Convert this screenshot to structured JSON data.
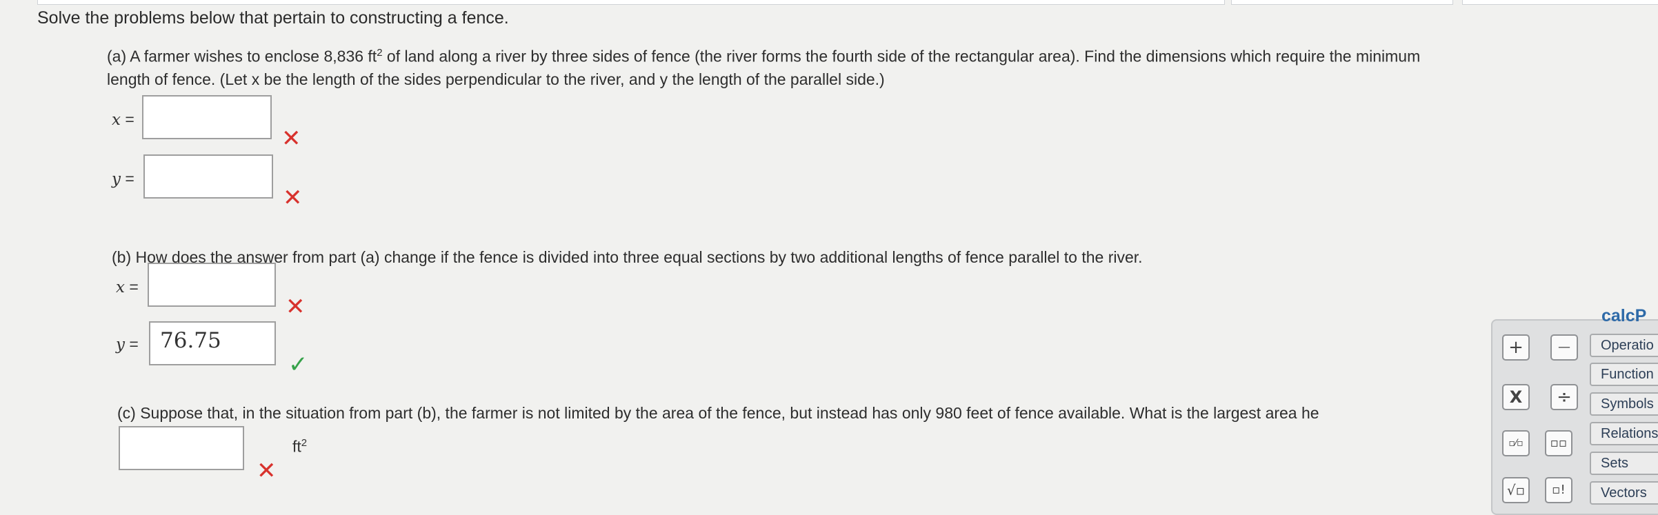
{
  "intro": "Solve the problems below that pertain to constructing a fence.",
  "part_a": {
    "text_line1_pre": "(a) A farmer wishes to enclose 8,836 ft",
    "text_line1_sup": "2",
    "text_line1_post": " of land along a river by three sides of fence (the river forms the fourth side of the rectangular area). Find the dimensions which require the minimum",
    "text_line2": "length of fence. (Let x be the length of the sides perpendicular to the river, and y the length of the parallel side.)",
    "x_label": "x",
    "y_label": "y",
    "eq": " =",
    "x_value": "",
    "y_value": ""
  },
  "part_b": {
    "text": "(b) How does the answer from part (a) change if the fence is divided into three equal sections by two additional lengths of fence parallel to the river.",
    "x_label": "x",
    "y_label": "y",
    "eq": " =",
    "x_value": "",
    "y_value": "76.75"
  },
  "part_c": {
    "text": "(c) Suppose that, in the situation from part (b), the farmer is not limited by the area of the fence, but instead has only 980 feet of fence available. What is the largest area he",
    "value": "",
    "unit": "ft",
    "unit_sup": "2"
  },
  "marks": {
    "wrong": "✕",
    "right": "✓"
  },
  "calc_keys": {
    "plus": "+",
    "minus": "—",
    "times": "X",
    "divide": "÷",
    "fraction": "▫⁄▫",
    "power": "▫▫",
    "sqrt": "√▫",
    "factorial": "▫!"
  },
  "calcpad": {
    "title": "calcP",
    "items": [
      "Operatio",
      "Function",
      "Symbols",
      "Relations",
      "Sets",
      "Vectors"
    ]
  },
  "colors": {
    "wrong": "#d8322d",
    "right": "#36a24a",
    "calcpad_title": "#2e6aa8"
  }
}
